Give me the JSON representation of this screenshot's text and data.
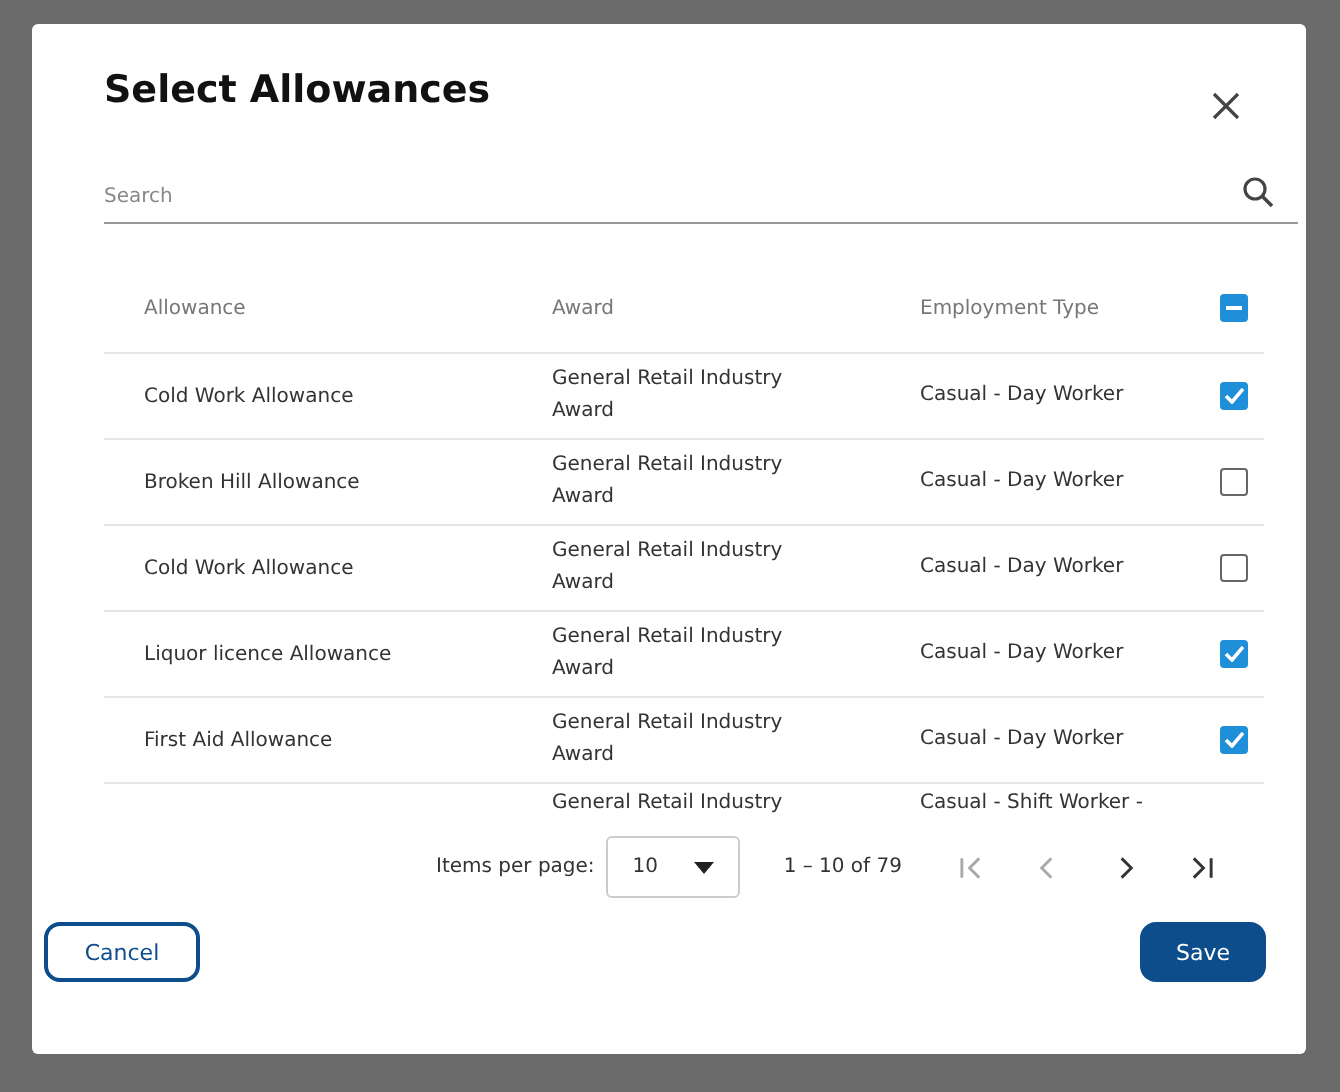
{
  "dialog": {
    "title": "Select Allowances"
  },
  "search": {
    "placeholder": "Search"
  },
  "table": {
    "columns": [
      "Allowance",
      "Award",
      "Employment Type"
    ],
    "header_checkbox": {
      "indeterminate": true
    },
    "rows": [
      {
        "allowance": "Cold Work Allowance",
        "award": [
          "General Retail Industry",
          "Award"
        ],
        "employment_type": [
          "Casual - Day Worker"
        ],
        "checked": true
      },
      {
        "allowance": "Broken Hill Allowance",
        "award": [
          "General Retail Industry",
          "Award"
        ],
        "employment_type": [
          "Casual - Day Worker"
        ],
        "checked": false
      },
      {
        "allowance": "Cold Work Allowance",
        "award": [
          "General Retail Industry",
          "Award"
        ],
        "employment_type": [
          "Casual - Day Worker"
        ],
        "checked": false
      },
      {
        "allowance": "Liquor licence Allowance",
        "award": [
          "General Retail Industry",
          "Award"
        ],
        "employment_type": [
          "Casual - Day Worker"
        ],
        "checked": true
      },
      {
        "allowance": "First Aid Allowance",
        "award": [
          "General Retail Industry",
          "Award"
        ],
        "employment_type": [
          "Casual - Day Worker"
        ],
        "checked": true
      },
      {
        "award": [
          "General Retail Industry"
        ],
        "employment_type": [
          "Casual - Shift Worker -"
        ]
      }
    ]
  },
  "paginator": {
    "items_per_page_label": "Items per page:",
    "page_size": "10",
    "range": "1 – 10 of 79"
  },
  "buttons": {
    "cancel": "Cancel",
    "save": "Save"
  }
}
